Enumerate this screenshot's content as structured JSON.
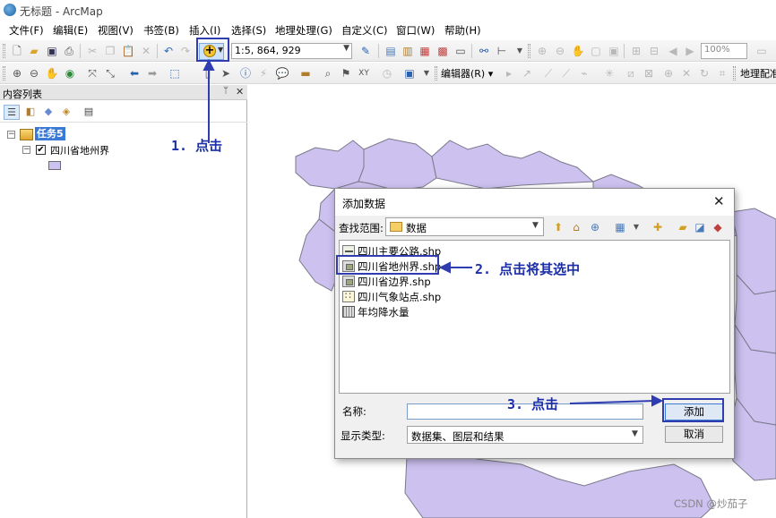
{
  "window": {
    "title": "无标题 - ArcMap"
  },
  "menu": [
    "文件(F)",
    "编辑(E)",
    "视图(V)",
    "书签(B)",
    "插入(I)",
    "选择(S)",
    "地理处理(G)",
    "自定义(C)",
    "窗口(W)",
    "帮助(H)"
  ],
  "toolbar": {
    "scale": "1:5, 864, 929",
    "zoom_percent": "100%",
    "editor_menu": "编辑器(R) ▾",
    "layout_tools": "地理配准"
  },
  "toc": {
    "title": "内容列表",
    "data_frame": "任务5",
    "layer": {
      "name": "四川省地州界",
      "checked": "✔",
      "symbol_color": "#ccc1ef"
    }
  },
  "dialog": {
    "title": "添加数据",
    "look_in_label": "查找范围:",
    "look_in_value": "数据",
    "files": [
      {
        "name": "四川主要公路.shp",
        "icon": "polyline-shapefile-icon"
      },
      {
        "name": "四川省地州界.shp",
        "icon": "polygon-shapefile-icon"
      },
      {
        "name": "四川省边界.shp",
        "icon": "polygon-shapefile-icon"
      },
      {
        "name": "四川气象站点.shp",
        "icon": "point-shapefile-icon"
      },
      {
        "name": "年均降水量",
        "icon": "raster-icon"
      }
    ],
    "name_label": "名称:",
    "name_value": "",
    "type_label": "显示类型:",
    "type_value": "数据集、图层和结果",
    "add_button": "添加",
    "cancel_button": "取消"
  },
  "annotations": {
    "step1": "1. 点击",
    "step2": "2. 点击将其选中",
    "step3": "3. 点击",
    "color": "#1c2ea8"
  },
  "map": {
    "fill_color": "#ccc1ef",
    "stroke_color": "#7a7a8a"
  },
  "watermark": "CSDN @炒茄子"
}
